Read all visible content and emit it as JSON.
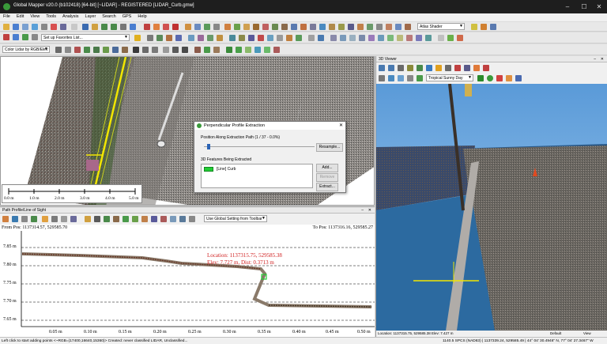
{
  "app": {
    "title": "Global Mapper v20.0 (b102418) [64-bit] [~LIDAR] - REGISTERED [LIDAR_Curb.gmw]"
  },
  "menu": [
    "File",
    "Edit",
    "View",
    "Tools",
    "Analysis",
    "Layer",
    "Search",
    "GPS",
    "Help"
  ],
  "toolbar": {
    "favorites_placeholder": "Set up Favorites List...",
    "shader": "Atlas Shader",
    "color_mode": "Color Lidar by RGB/Elev"
  },
  "scale_bar": [
    "0.0 m",
    "1.0 m",
    "2.0 m",
    "3.0 m",
    "4.0 m",
    "5.0 m"
  ],
  "dialog": {
    "title": "Perpendicular Profile Extraction",
    "position_label": "Position Along Extraction Path (1 / 37 - 0.0%)",
    "position_value": 0.03,
    "resample": "Resample...",
    "features_label": "3D Features Being Extracted",
    "feature": "[Line] Curb",
    "add": "Add...",
    "remove": "Remove",
    "extract": "Extract..."
  },
  "viewer3d": {
    "title": "3D Viewer",
    "sky": "Tropical Sunny Day"
  },
  "profile": {
    "title": "Path Profile/Line of Sight",
    "setting": "Use Global Setting from Toolbar",
    "from": "From Pos: 1137314.57, 529585.70",
    "to": "To Pos: 1137316.16, 529585.27",
    "location": "Location: 1137315.75, 529585.38",
    "elev": "Elev: 7.727 m, Dist: 0.3713 m",
    "yticks": [
      "7.85 m",
      "7.80 m",
      "7.75 m",
      "7.70 m",
      "7.65 m"
    ],
    "xticks": [
      "0.05 m",
      "0.10 m",
      "0.15 m",
      "0.20 m",
      "0.25 m",
      "0.30 m",
      "0.35 m",
      "0.40 m",
      "0.45 m",
      "0.50 m"
    ]
  },
  "status": {
    "left": "Left click to start adding points <~RGB=(17400,16640,15360)> Created: never classified LIDAR, Unclassified...",
    "location": "Location: 1137315.75, 529585.38 Elev: 7.427 m",
    "default": "Default",
    "view": "View",
    "coords": "1140.5 SPCS (NAD83) | 1137339.24, 529585.49 | 44° 04' 30.4946\" N, 77° 04' 27.3467\" W"
  },
  "colors": {
    "accent": "#2a63b5",
    "feature": "#22cc33",
    "curb": "#f2e600"
  }
}
